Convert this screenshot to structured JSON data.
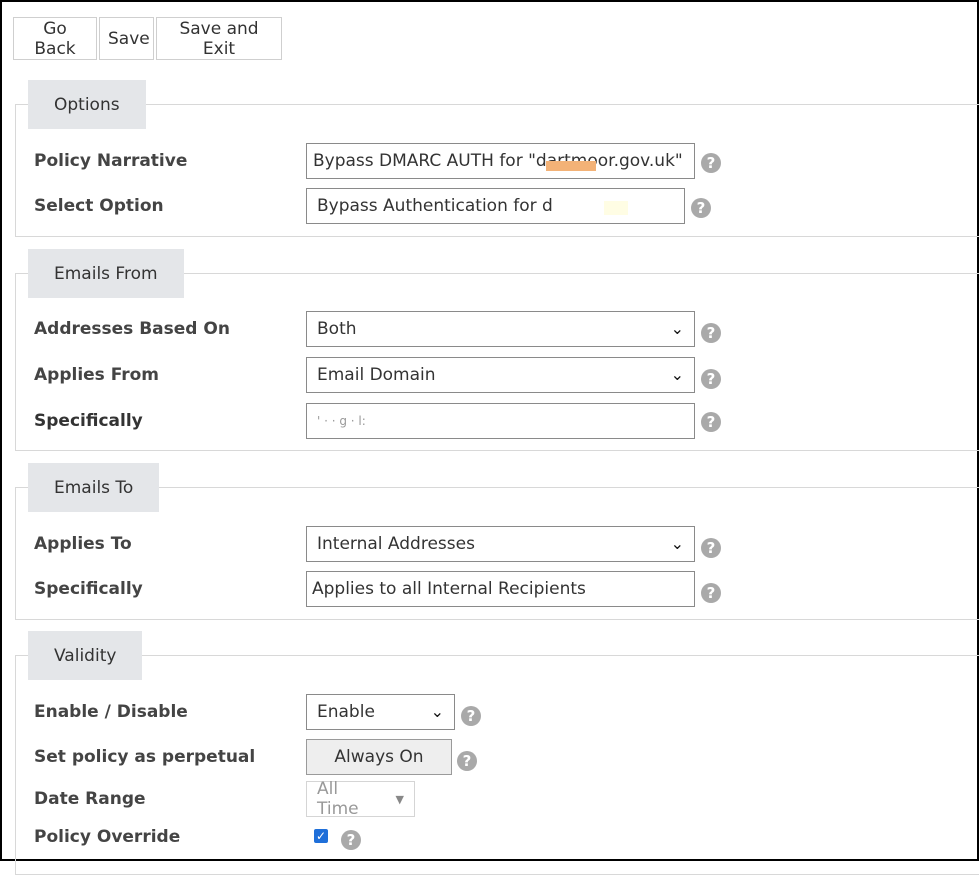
{
  "toolbar": {
    "go_back": "Go Back",
    "save": "Save",
    "save_exit": "Save and Exit"
  },
  "help_glyph": "?",
  "options": {
    "legend": "Options",
    "policy_narrative_label": "Policy Narrative",
    "policy_narrative_value": "Bypass DMARC AUTH for \"dartmoor.gov.uk\"",
    "select_option_label": "Select Option",
    "select_option_value": "Bypass Authentication for d"
  },
  "emails_from": {
    "legend": "Emails From",
    "addresses_based_on_label": "Addresses Based On",
    "addresses_based_on_value": "Both",
    "applies_from_label": "Applies From",
    "applies_from_value": "Email Domain",
    "specifically_label": "Specifically",
    "specifically_value": "'  ·  ·     g    ·  l:"
  },
  "emails_to": {
    "legend": "Emails To",
    "applies_to_label": "Applies To",
    "applies_to_value": "Internal Addresses",
    "specifically_label": "Specifically",
    "specifically_value": "Applies to all Internal Recipients"
  },
  "validity": {
    "legend": "Validity",
    "enable_disable_label": "Enable / Disable",
    "enable_disable_value": "Enable",
    "perpetual_label": "Set policy as perpetual",
    "perpetual_button": "Always On",
    "date_range_label": "Date Range",
    "date_range_value": "All Time",
    "policy_override_label": "Policy Override",
    "policy_override_checked": true
  },
  "colors": {
    "legend_bg": "#e4e6e9",
    "help_icon": "#a9a9a9",
    "checkbox": "#1f6fd9"
  }
}
